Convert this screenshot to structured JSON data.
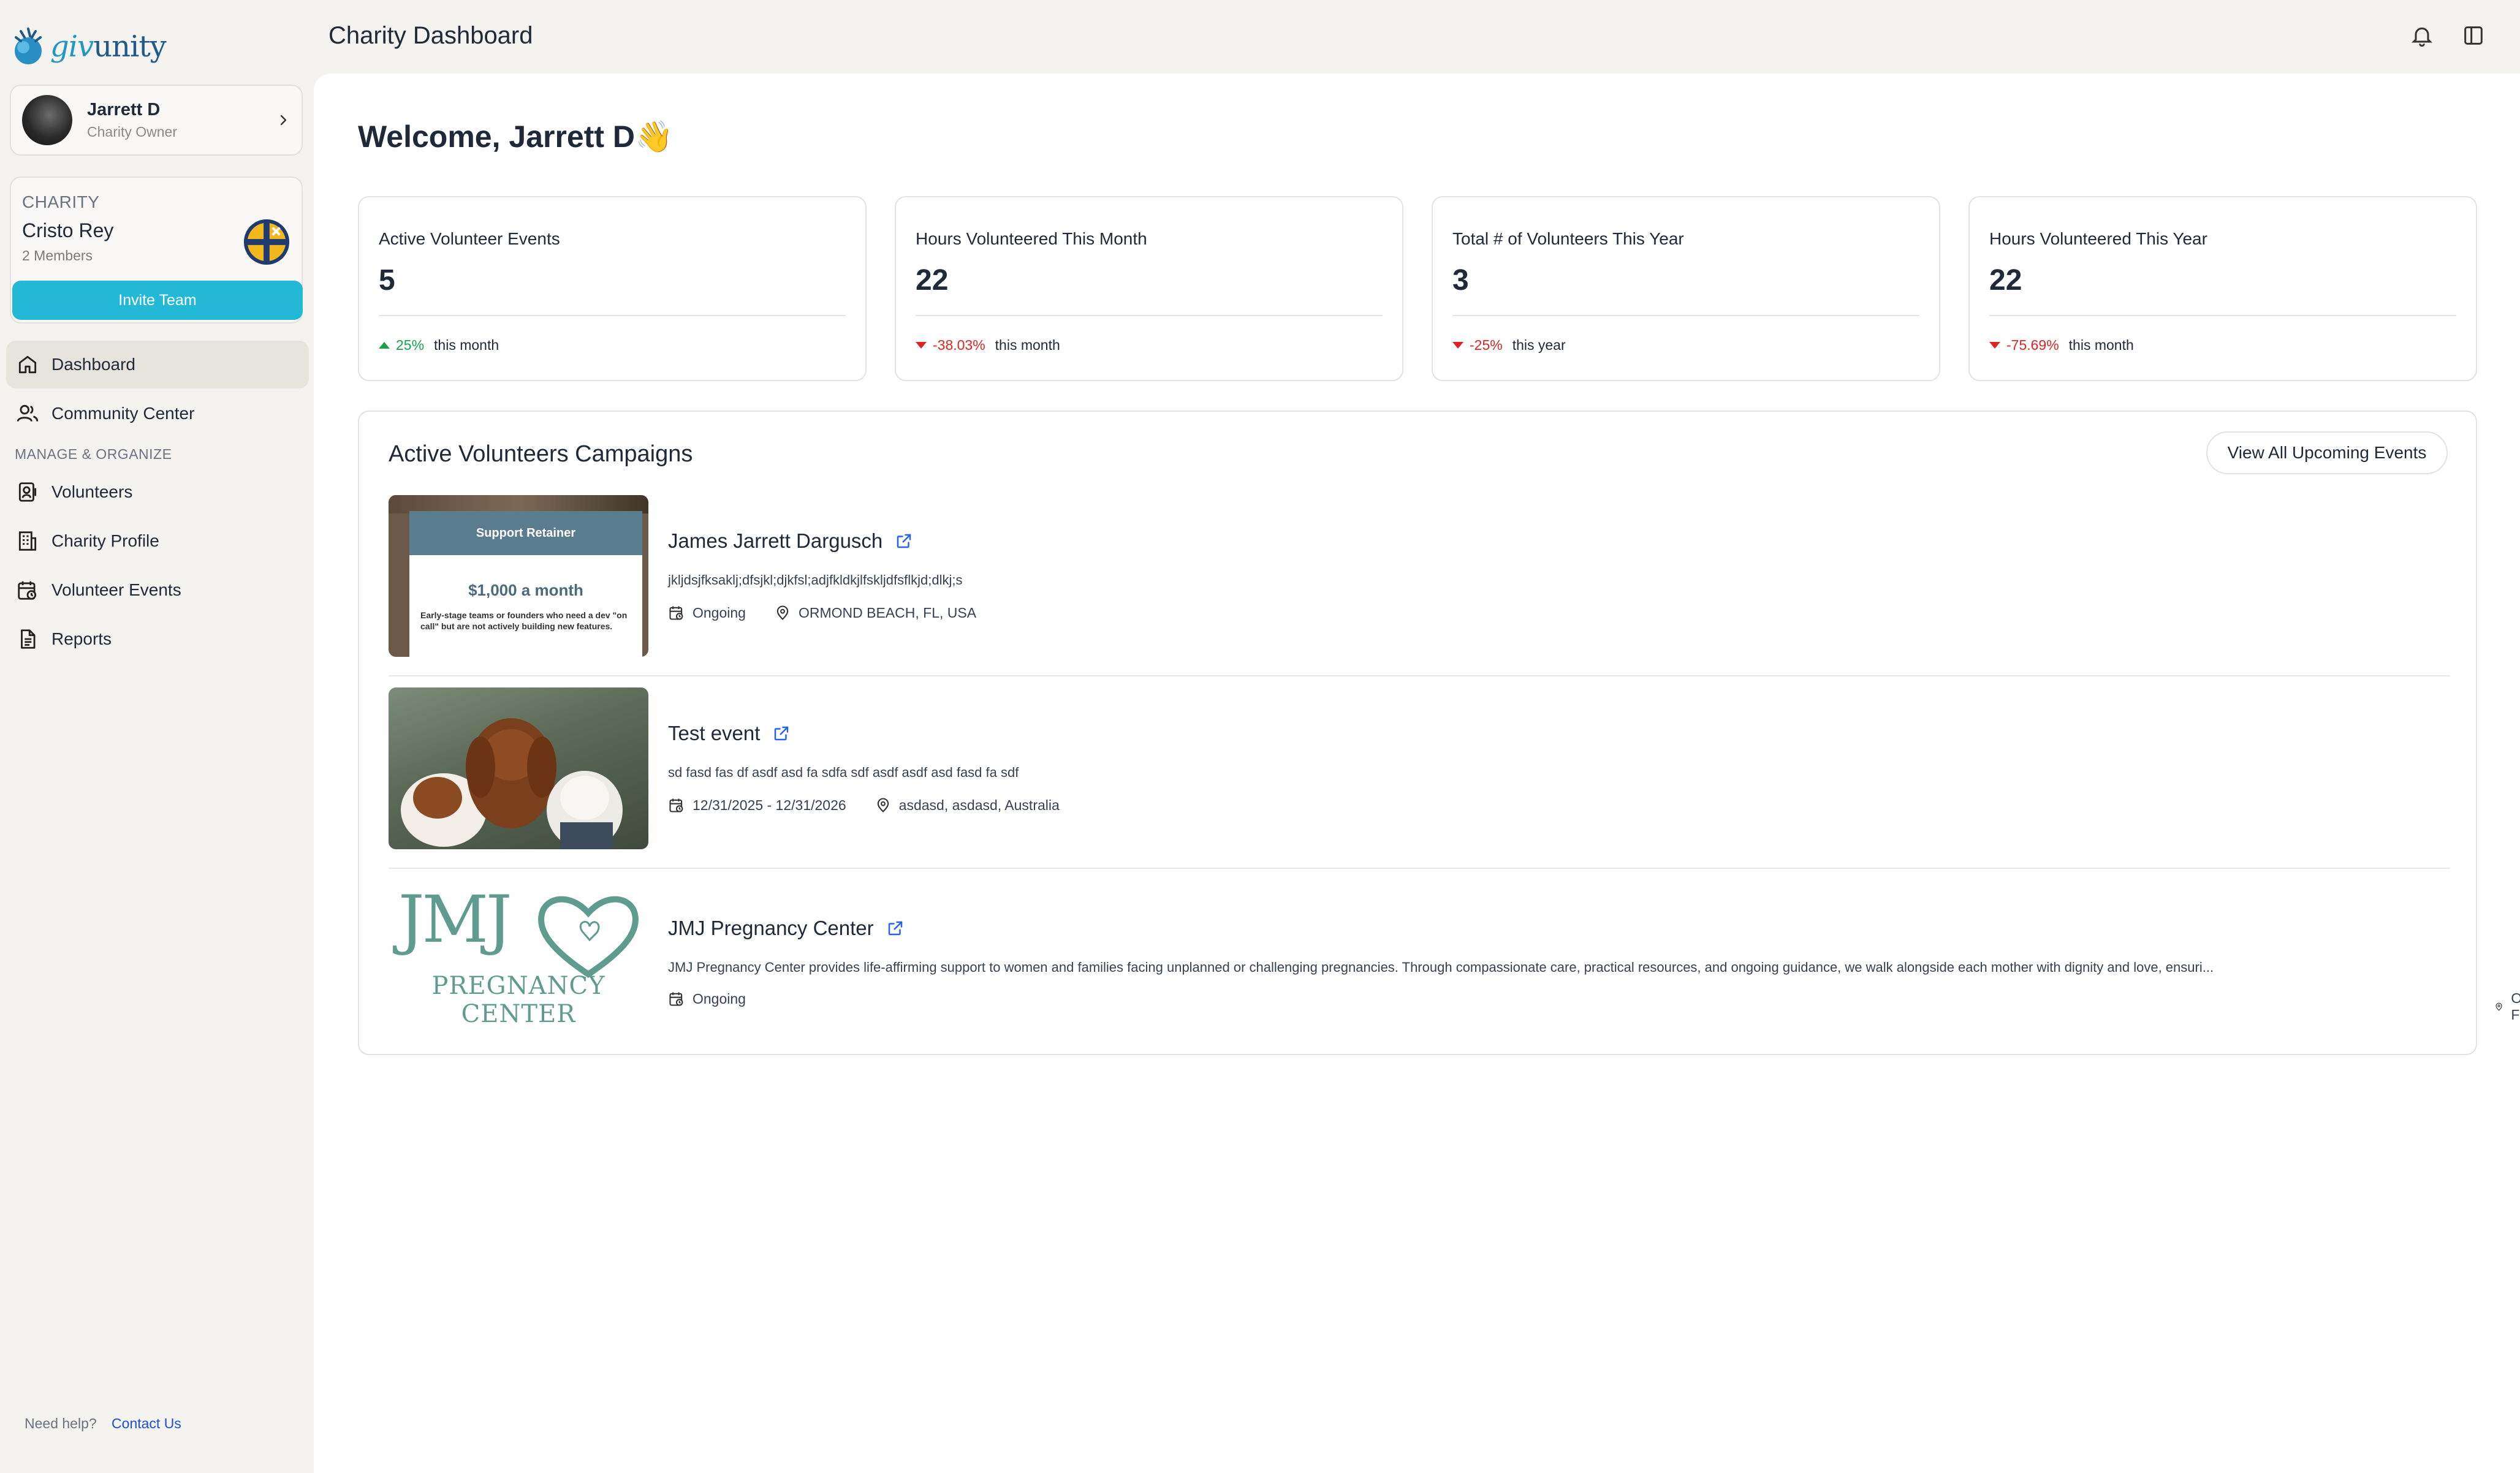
{
  "brand": {
    "logo_prefix": "giv",
    "logo_suffix": "unity",
    "icon": "givunity-logo-icon"
  },
  "user": {
    "name": "Jarrett D",
    "role": "Charity Owner"
  },
  "charity": {
    "label": "CHARITY",
    "name": "Cristo Rey",
    "members": "2 Members",
    "invite_label": "Invite Team"
  },
  "nav": {
    "dashboard": "Dashboard",
    "community": "Community Center",
    "section": "MANAGE & ORGANIZE",
    "volunteers": "Volunteers",
    "charity_profile": "Charity Profile",
    "volunteer_events": "Volunteer Events",
    "reports": "Reports"
  },
  "help": {
    "text": "Need help?",
    "link": "Contact Us"
  },
  "header": {
    "title": "Charity Dashboard"
  },
  "welcome": "Welcome, Jarrett D👋",
  "stats": [
    {
      "title": "Active Volunteer Events",
      "value": "5",
      "change": "25%",
      "direction": "up",
      "period": "this month"
    },
    {
      "title": "Hours Volunteered This Month",
      "value": "22",
      "change": "-38.03%",
      "direction": "down",
      "period": "this month"
    },
    {
      "title": "Total # of Volunteers This Year",
      "value": "3",
      "change": "-25%",
      "direction": "down",
      "period": "this year"
    },
    {
      "title": "Hours Volunteered This Year",
      "value": "22",
      "change": "-75.69%",
      "direction": "down",
      "period": "this month"
    }
  ],
  "campaigns": {
    "title": "Active Volunteers Campaigns",
    "view_all_label": "View All Upcoming Events",
    "events": [
      {
        "name": "James Jarrett Dargusch",
        "description": "jkljdsjfksaklj;dfsjkl;djkfsl;adjfkldkjlfskljdfsflkjd;dlkj;s",
        "date": "Ongoing",
        "location": "ORMOND BEACH, FL, USA",
        "thumb": {
          "banner": "Support Retainer",
          "price": "$1,000 a month",
          "body": "Early-stage teams or founders who need a dev \"on call\" but are not actively building new features."
        }
      },
      {
        "name": "Test event",
        "description": "sd fasd fas df asdf asd fa sdfa sdf asdf asdf asd fasd fa sdf",
        "date": "12/31/2025 - 12/31/2026",
        "location": "asdasd, asdasd, Australia"
      },
      {
        "name": "JMJ Pregnancy Center",
        "description": "JMJ Pregnancy Center provides life-affirming support to women and families facing unplanned or challenging pregnancies. Through compassionate care, practical resources, and ongoing guidance, we walk alongside each mother with dignity and love, ensuri...",
        "date": "Ongoing",
        "location": "Orlando, FL, USA",
        "thumb": {
          "line1": "JMJ",
          "line2": "PREGNANCY",
          "line3": "CENTER"
        }
      }
    ]
  },
  "colors": {
    "accent": "#22b8d6",
    "up": "#16a34a",
    "down": "#dc2626",
    "link": "#1d4ed8",
    "jmj": "#5f9c8f"
  }
}
